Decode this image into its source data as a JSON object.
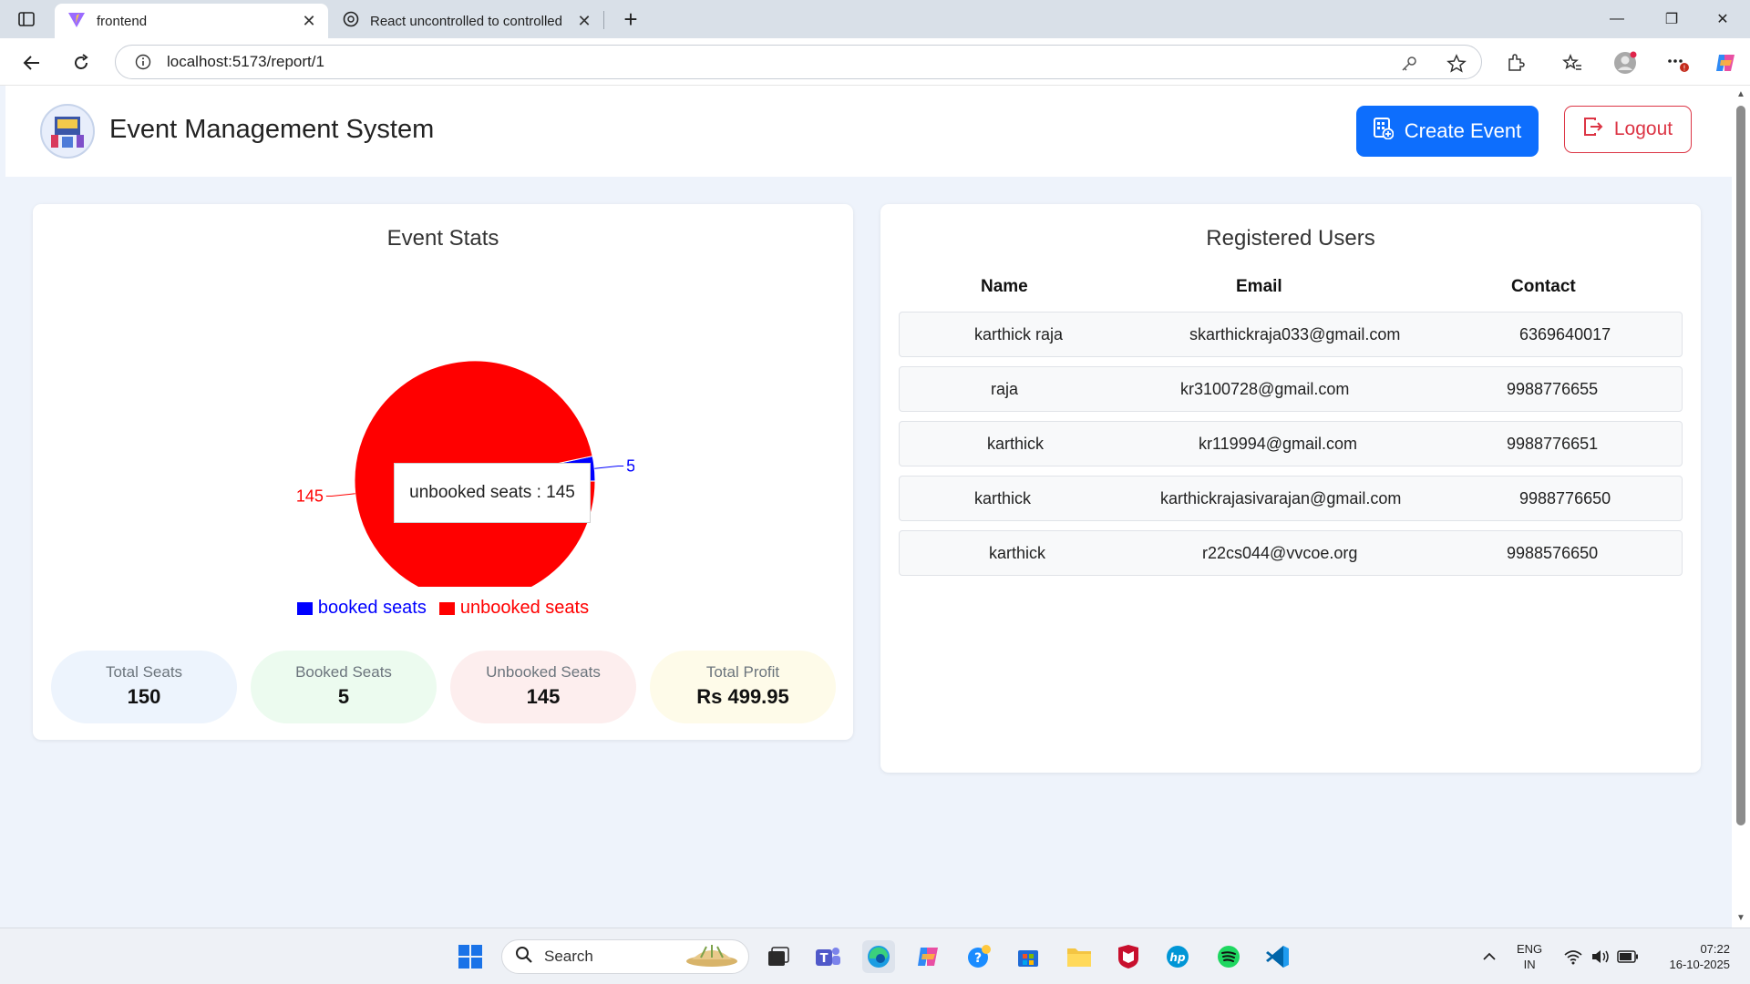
{
  "browser": {
    "tabs": [
      {
        "title": "frontend",
        "active": true
      },
      {
        "title": "React uncontrolled to controlled",
        "active": false
      }
    ],
    "url": "localhost:5173/report/1"
  },
  "header": {
    "title": "Event Management System",
    "create_label": "Create Event",
    "logout_label": "Logout"
  },
  "stats": {
    "title": "Event Stats",
    "tooltip": "unbooked seats : 145",
    "pills": [
      {
        "label": "Total Seats",
        "value": "150",
        "color": "#edf4fd"
      },
      {
        "label": "Booked Seats",
        "value": "5",
        "color": "#ecfbef"
      },
      {
        "label": "Unbooked Seats",
        "value": "145",
        "color": "#fdeeee"
      },
      {
        "label": "Total Profit",
        "value": "Rs 499.95",
        "color": "#fefbe9"
      }
    ]
  },
  "chart_data": {
    "type": "pie",
    "title": "",
    "slices": [
      {
        "name": "booked seats",
        "value": 5,
        "color": "#0000ff"
      },
      {
        "name": "unbooked seats",
        "value": 145,
        "color": "#ff0000"
      }
    ],
    "legend_position": "bottom"
  },
  "users": {
    "title": "Registered Users",
    "columns": [
      "Name",
      "Email",
      "Contact"
    ],
    "rows": [
      {
        "name": "karthick raja",
        "email": "skarthickraja033@gmail.com",
        "contact": "6369640017"
      },
      {
        "name": "raja",
        "email": "kr3100728@gmail.com",
        "contact": "9988776655"
      },
      {
        "name": "karthick",
        "email": "kr119994@gmail.com",
        "contact": "9988776651"
      },
      {
        "name": "karthick",
        "email": "karthickrajasivarajan@gmail.com",
        "contact": "9988776650"
      },
      {
        "name": "karthick",
        "email": "r22cs044@vvcoe.org",
        "contact": "9988576650"
      }
    ]
  },
  "taskbar": {
    "search_label": "Search",
    "lang_line1": "ENG",
    "lang_line2": "IN",
    "time": "07:22",
    "date": "16-10-2025"
  }
}
